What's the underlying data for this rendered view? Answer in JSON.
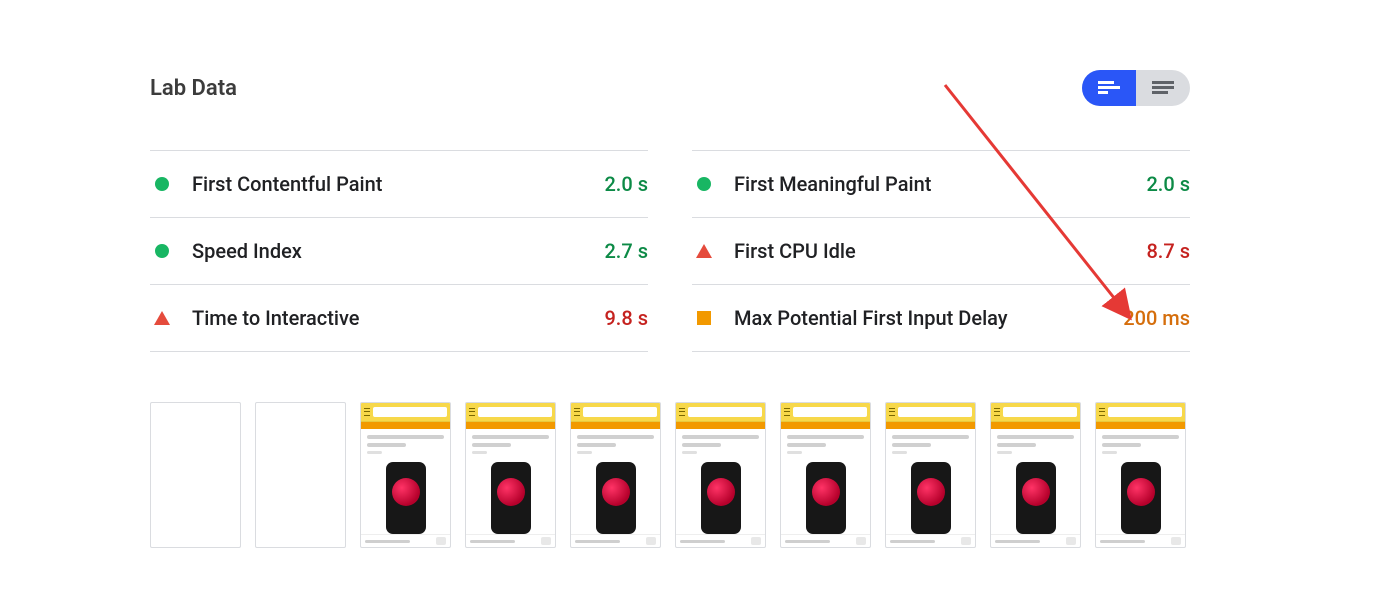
{
  "header": {
    "title": "Lab Data"
  },
  "metrics": {
    "left": [
      {
        "label": "First Contentful Paint",
        "value": "2.0 s",
        "status": "green"
      },
      {
        "label": "Speed Index",
        "value": "2.7 s",
        "status": "green"
      },
      {
        "label": "Time to Interactive",
        "value": "9.8 s",
        "status": "red"
      }
    ],
    "right": [
      {
        "label": "First Meaningful Paint",
        "value": "2.0 s",
        "status": "green"
      },
      {
        "label": "First CPU Idle",
        "value": "8.7 s",
        "status": "red"
      },
      {
        "label": "Max Potential First Input Delay",
        "value": "200 ms",
        "status": "orange"
      }
    ]
  },
  "filmstrip": {
    "frames": [
      {
        "rendered": false
      },
      {
        "rendered": false
      },
      {
        "rendered": true
      },
      {
        "rendered": true
      },
      {
        "rendered": true
      },
      {
        "rendered": true
      },
      {
        "rendered": true
      },
      {
        "rendered": true
      },
      {
        "rendered": true
      },
      {
        "rendered": true
      }
    ]
  },
  "toggle": {
    "mode": "gauge"
  },
  "colors": {
    "green": "#0c8a46",
    "red": "#c5221f",
    "orange": "#d56e0c",
    "accent": "#2a56f7"
  }
}
